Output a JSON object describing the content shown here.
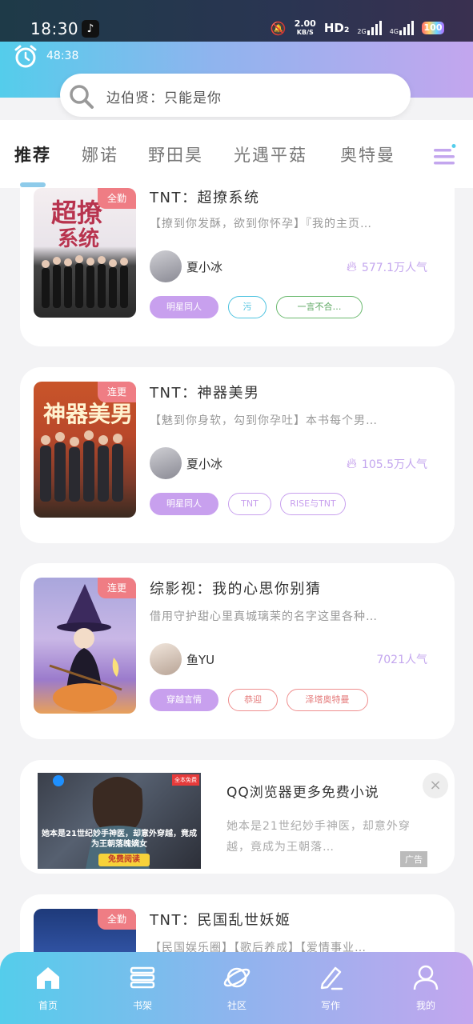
{
  "status": {
    "time": "18:30",
    "speed_value": "2.00",
    "speed_unit": "KB/S",
    "hd": "HD₂",
    "net1": "2G",
    "net2": "4G",
    "battery": "100"
  },
  "header": {
    "alarm_time": "48:38",
    "search_placeholder": "边伯贤：只能是你"
  },
  "tabs": [
    {
      "label": "推荐"
    },
    {
      "label": "娜诺"
    },
    {
      "label": "野田昊"
    },
    {
      "label": "光遇平菇"
    },
    {
      "label": "奥特曼"
    }
  ],
  "books": [
    {
      "badge": "全勤",
      "title": "TNT：超撩系统",
      "desc": "【撩到你发酥，欲到你怀孕】『我的主页…",
      "author": "夏小冰",
      "popularity": "577.1万人气",
      "tags": [
        "明星同人",
        "污",
        "一言不合…"
      ]
    },
    {
      "badge": "连更",
      "title": "TNT：神器美男",
      "desc": "【魅到你身软，勾到你孕吐】本书每个男…",
      "author": "夏小冰",
      "popularity": "105.5万人气",
      "tags": [
        "明星同人",
        "TNT",
        "RISE与TNT"
      ]
    },
    {
      "badge": "连更",
      "title": "综影视：我的心思你别猜",
      "desc": "借用守护甜心里真城璃茉的名字这里各种…",
      "author": "鱼YU",
      "popularity": "7021人气",
      "tags": [
        "穿越言情",
        "恭迎",
        "泽塔奥特曼"
      ]
    }
  ],
  "ad": {
    "title": "QQ浏览器更多免费小说",
    "desc": "她本是21世纪妙手神医，却意外穿越，竟成为王朝落…",
    "image_caption": "她本是21世纪妙手神医，却意外穿越，竟成为王朝落魄嫡女",
    "image_button": "免费阅读",
    "image_corner": "全本免费",
    "close": "×",
    "label": "广告"
  },
  "partial_book": {
    "badge": "全勤",
    "title": "TNT：民国乱世妖姬",
    "desc": "【民国娱乐圈】【歌后养成】【爱情事业…"
  },
  "nav": [
    {
      "label": "首页",
      "icon": "home-icon"
    },
    {
      "label": "书架",
      "icon": "bookshelf-icon"
    },
    {
      "label": "社区",
      "icon": "planet-icon"
    },
    {
      "label": "写作",
      "icon": "pen-icon"
    },
    {
      "label": "我的",
      "icon": "user-icon"
    }
  ],
  "colors": {
    "accent_start": "#54cdeb",
    "accent_end": "#c3a6ee",
    "badge": "#ef7d84",
    "tag_fill": "#c8a0ee"
  }
}
